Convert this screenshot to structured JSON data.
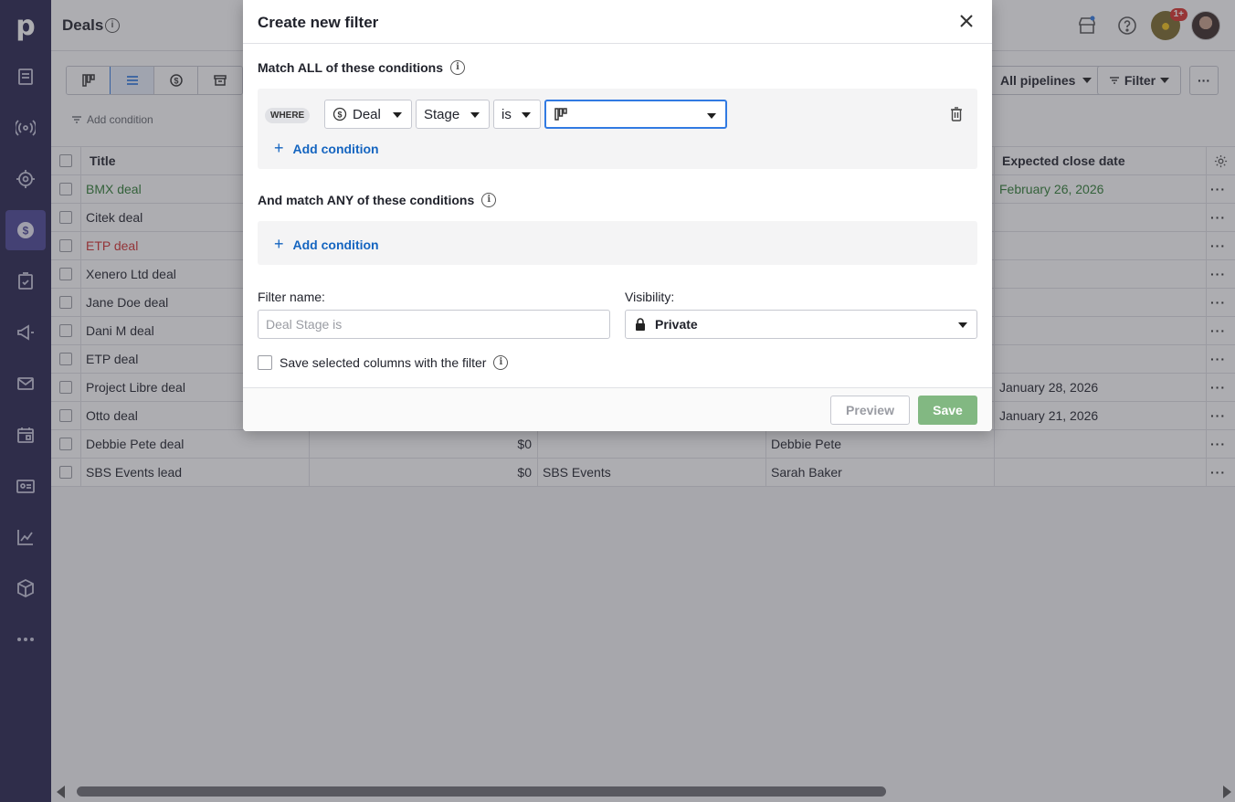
{
  "app": {
    "logo": "p",
    "page_title": "Deals"
  },
  "topbar": {
    "notification_badge": "1+"
  },
  "toolbar": {
    "add_condition": "Add condition",
    "pipelines": "All pipelines",
    "filter": "Filter",
    "more": "···"
  },
  "table": {
    "headers": [
      "Title",
      "Expected close date"
    ],
    "rows": [
      {
        "title": "BMX deal",
        "value": "",
        "org": "",
        "person": "",
        "close": "February 26, 2026",
        "color": "#2e7d32"
      },
      {
        "title": "Citek deal",
        "value": "",
        "org": "",
        "person": "",
        "close": "",
        "color": "#21232c"
      },
      {
        "title": "ETP deal",
        "value": "",
        "org": "",
        "person": "",
        "close": "",
        "color": "#d32f2f"
      },
      {
        "title": "Xenero Ltd deal",
        "value": "",
        "org": "",
        "person": "",
        "close": "",
        "color": "#21232c"
      },
      {
        "title": "Jane Doe deal",
        "value": "",
        "org": "",
        "person": "",
        "close": "",
        "color": "#21232c"
      },
      {
        "title": "Dani M deal",
        "value": "",
        "org": "",
        "person": "",
        "close": "",
        "color": "#21232c"
      },
      {
        "title": "ETP deal",
        "value": "",
        "org": "",
        "person": "",
        "close": "",
        "color": "#21232c"
      },
      {
        "title": "Project Libre deal",
        "value": "",
        "org": "",
        "person": "",
        "close": "January 28, 2026",
        "color": "#21232c"
      },
      {
        "title": "Otto deal",
        "value": "",
        "org": "",
        "person": "",
        "close": "January 21, 2026",
        "color": "#21232c"
      },
      {
        "title": "Debbie Pete deal",
        "value": "$0",
        "org": "",
        "person": "Debbie Pete",
        "close": "",
        "color": "#21232c"
      },
      {
        "title": "SBS Events lead",
        "value": "$0",
        "org": "SBS Events",
        "person": "Sarah Baker",
        "close": "",
        "color": "#21232c"
      }
    ],
    "row_menu": "···"
  },
  "modal": {
    "title": "Create new filter",
    "match_all_label": "Match ALL of these conditions",
    "where_badge": "WHERE",
    "condition": {
      "entity": "Deal",
      "field": "Stage",
      "operator": "is",
      "value": ""
    },
    "add_condition": "Add condition",
    "match_any_label": "And match ANY of these conditions",
    "filter_name_label": "Filter name:",
    "filter_name_placeholder": "Deal Stage is",
    "visibility_label": "Visibility:",
    "visibility_value": "Private",
    "save_columns_label": "Save selected columns with the filter",
    "preview_button": "Preview",
    "save_button": "Save"
  },
  "icons": {
    "sidebar": [
      "leads-icon",
      "broadcast-icon",
      "target-icon",
      "deals-icon",
      "activities-icon",
      "campaigns-icon",
      "mail-icon",
      "calendar-icon",
      "contacts-icon",
      "insights-icon",
      "products-icon",
      "more-icon"
    ]
  },
  "colors": {
    "sidebar": "#26234f",
    "sidebar_active": "#4b4596",
    "link": "#1565c0",
    "save": "#82b882"
  }
}
